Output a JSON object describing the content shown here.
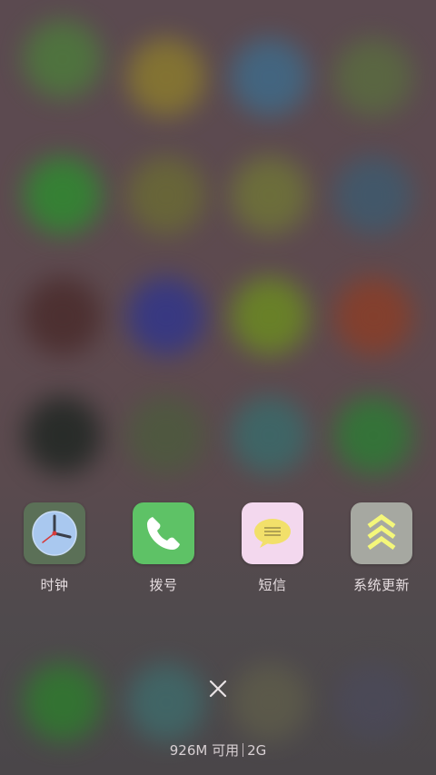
{
  "recent_apps": [
    {
      "label": "时钟",
      "icon": "clock-icon",
      "bg": "#5b7057"
    },
    {
      "label": "拨号",
      "icon": "phone-icon",
      "bg": "#5ec266"
    },
    {
      "label": "短信",
      "icon": "message-icon",
      "bg": "#f3d8ee"
    },
    {
      "label": "系统更新",
      "icon": "system-update-icon",
      "bg": "#a6a8a1"
    }
  ],
  "close_icon": "close-icon",
  "memory": {
    "available": "926M 可用",
    "total": "2G"
  },
  "colors": {
    "label_text": "#e6dde0",
    "background": "#5b4a50"
  }
}
